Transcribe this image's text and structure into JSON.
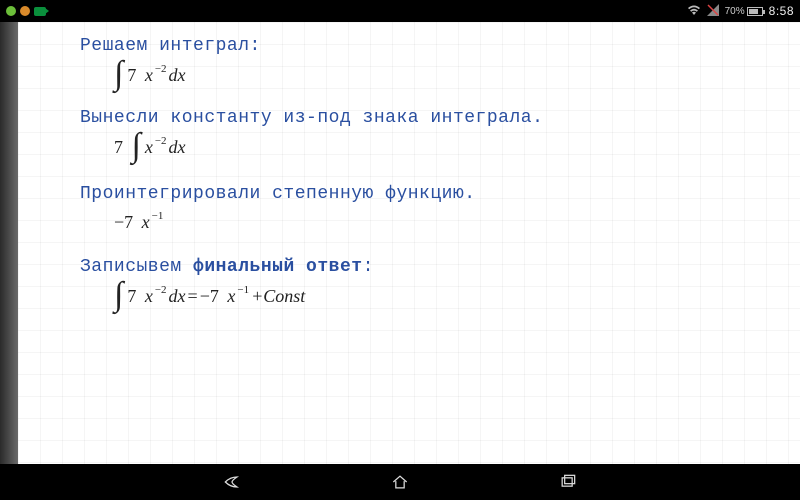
{
  "statusbar": {
    "battery_pct": "70%",
    "clock": "8:58"
  },
  "content": {
    "line1": "Решаем интеграл:",
    "line2": "Вынесли константу из-под знака интеграла.",
    "line3": "Проинтегрировали степенную функцию.",
    "line4_prefix": "Записывем ",
    "line4_bold": "финальный ответ",
    "line4_suffix": ":",
    "math": {
      "coef": "7",
      "integrand_base": "x",
      "integrand_exp": "−2",
      "dx": "dx",
      "result_coef": "−7",
      "result_exp": "−1",
      "const": "+Const",
      "eq": "="
    }
  }
}
